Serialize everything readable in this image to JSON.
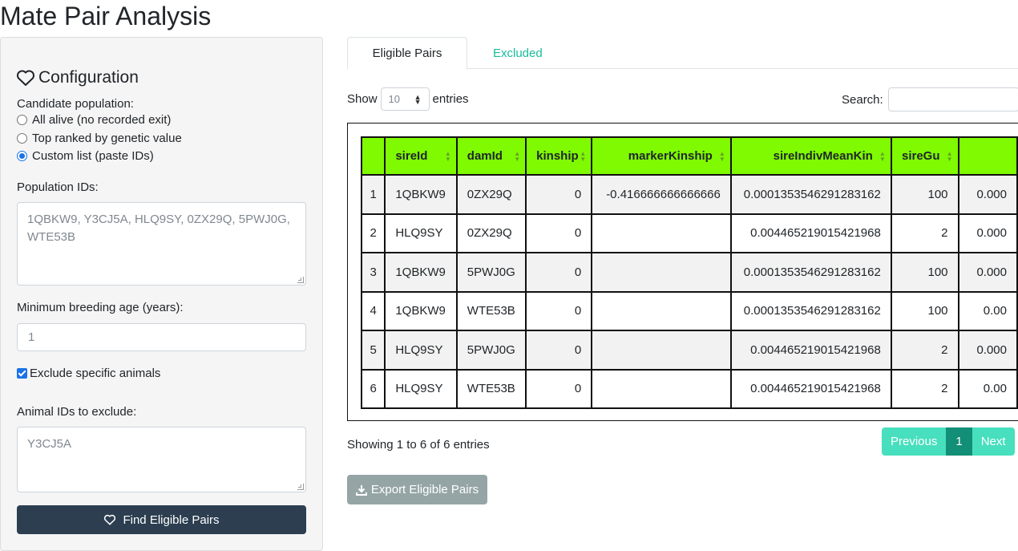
{
  "page": {
    "title": "Mate Pair Analysis"
  },
  "sidebar": {
    "heading": "Configuration",
    "heading_icon": "heart-icon",
    "candidate_label": "Candidate population:",
    "radio_options": [
      {
        "label": "All alive (no recorded exit)",
        "selected": false
      },
      {
        "label": "Top ranked by genetic value",
        "selected": false
      },
      {
        "label": "Custom list (paste IDs)",
        "selected": true
      }
    ],
    "population_ids_label": "Population IDs:",
    "population_ids_placeholder": "1QBKW9, Y3CJ5A, HLQ9SY, 0ZX29Q, 5PWJ0G, WTE53B",
    "min_age_label": "Minimum breeding age (years):",
    "min_age_value": "1",
    "exclude_checkbox_label": "Exclude specific animals",
    "exclude_checked": true,
    "exclude_ids_label": "Animal IDs to exclude:",
    "exclude_ids_placeholder": "Y3CJ5A",
    "find_button": "Find Eligible Pairs",
    "find_button_icon": "heart-icon",
    "find_button_color": "#2c3e50"
  },
  "tabs": [
    {
      "label": "Eligible Pairs",
      "active": true
    },
    {
      "label": "Excluded",
      "active": false
    }
  ],
  "table_controls": {
    "show_label": "Show",
    "entries_value": "10",
    "entries_label": "entries",
    "search_label": "Search:"
  },
  "table": {
    "header_color": "#7ffa00",
    "columns": [
      "",
      "sireId",
      "damId",
      "kinship",
      "markerKinship",
      "sireIndivMeanKin",
      "sireGu",
      ""
    ],
    "rows": [
      [
        "1",
        "1QBKW9",
        "0ZX29Q",
        "0",
        "-0.416666666666666",
        "0.0001353546291283162",
        "100",
        "0.000"
      ],
      [
        "2",
        "HLQ9SY",
        "0ZX29Q",
        "0",
        "",
        "0.004465219015421968",
        "2",
        "0.000"
      ],
      [
        "3",
        "1QBKW9",
        "5PWJ0G",
        "0",
        "",
        "0.0001353546291283162",
        "100",
        "0.000"
      ],
      [
        "4",
        "1QBKW9",
        "WTE53B",
        "0",
        "",
        "0.0001353546291283162",
        "100",
        "0.00"
      ],
      [
        "5",
        "HLQ9SY",
        "5PWJ0G",
        "0",
        "",
        "0.004465219015421968",
        "2",
        "0.000"
      ],
      [
        "6",
        "HLQ9SY",
        "WTE53B",
        "0",
        "",
        "0.004465219015421968",
        "2",
        "0.00"
      ]
    ]
  },
  "footer": {
    "info": "Showing 1 to 6 of 6 entries",
    "prev": "Previous",
    "current_page": "1",
    "next": "Next",
    "export_button": "Export Eligible Pairs",
    "export_icon": "download-icon",
    "accent_color": "#18bc9c"
  }
}
